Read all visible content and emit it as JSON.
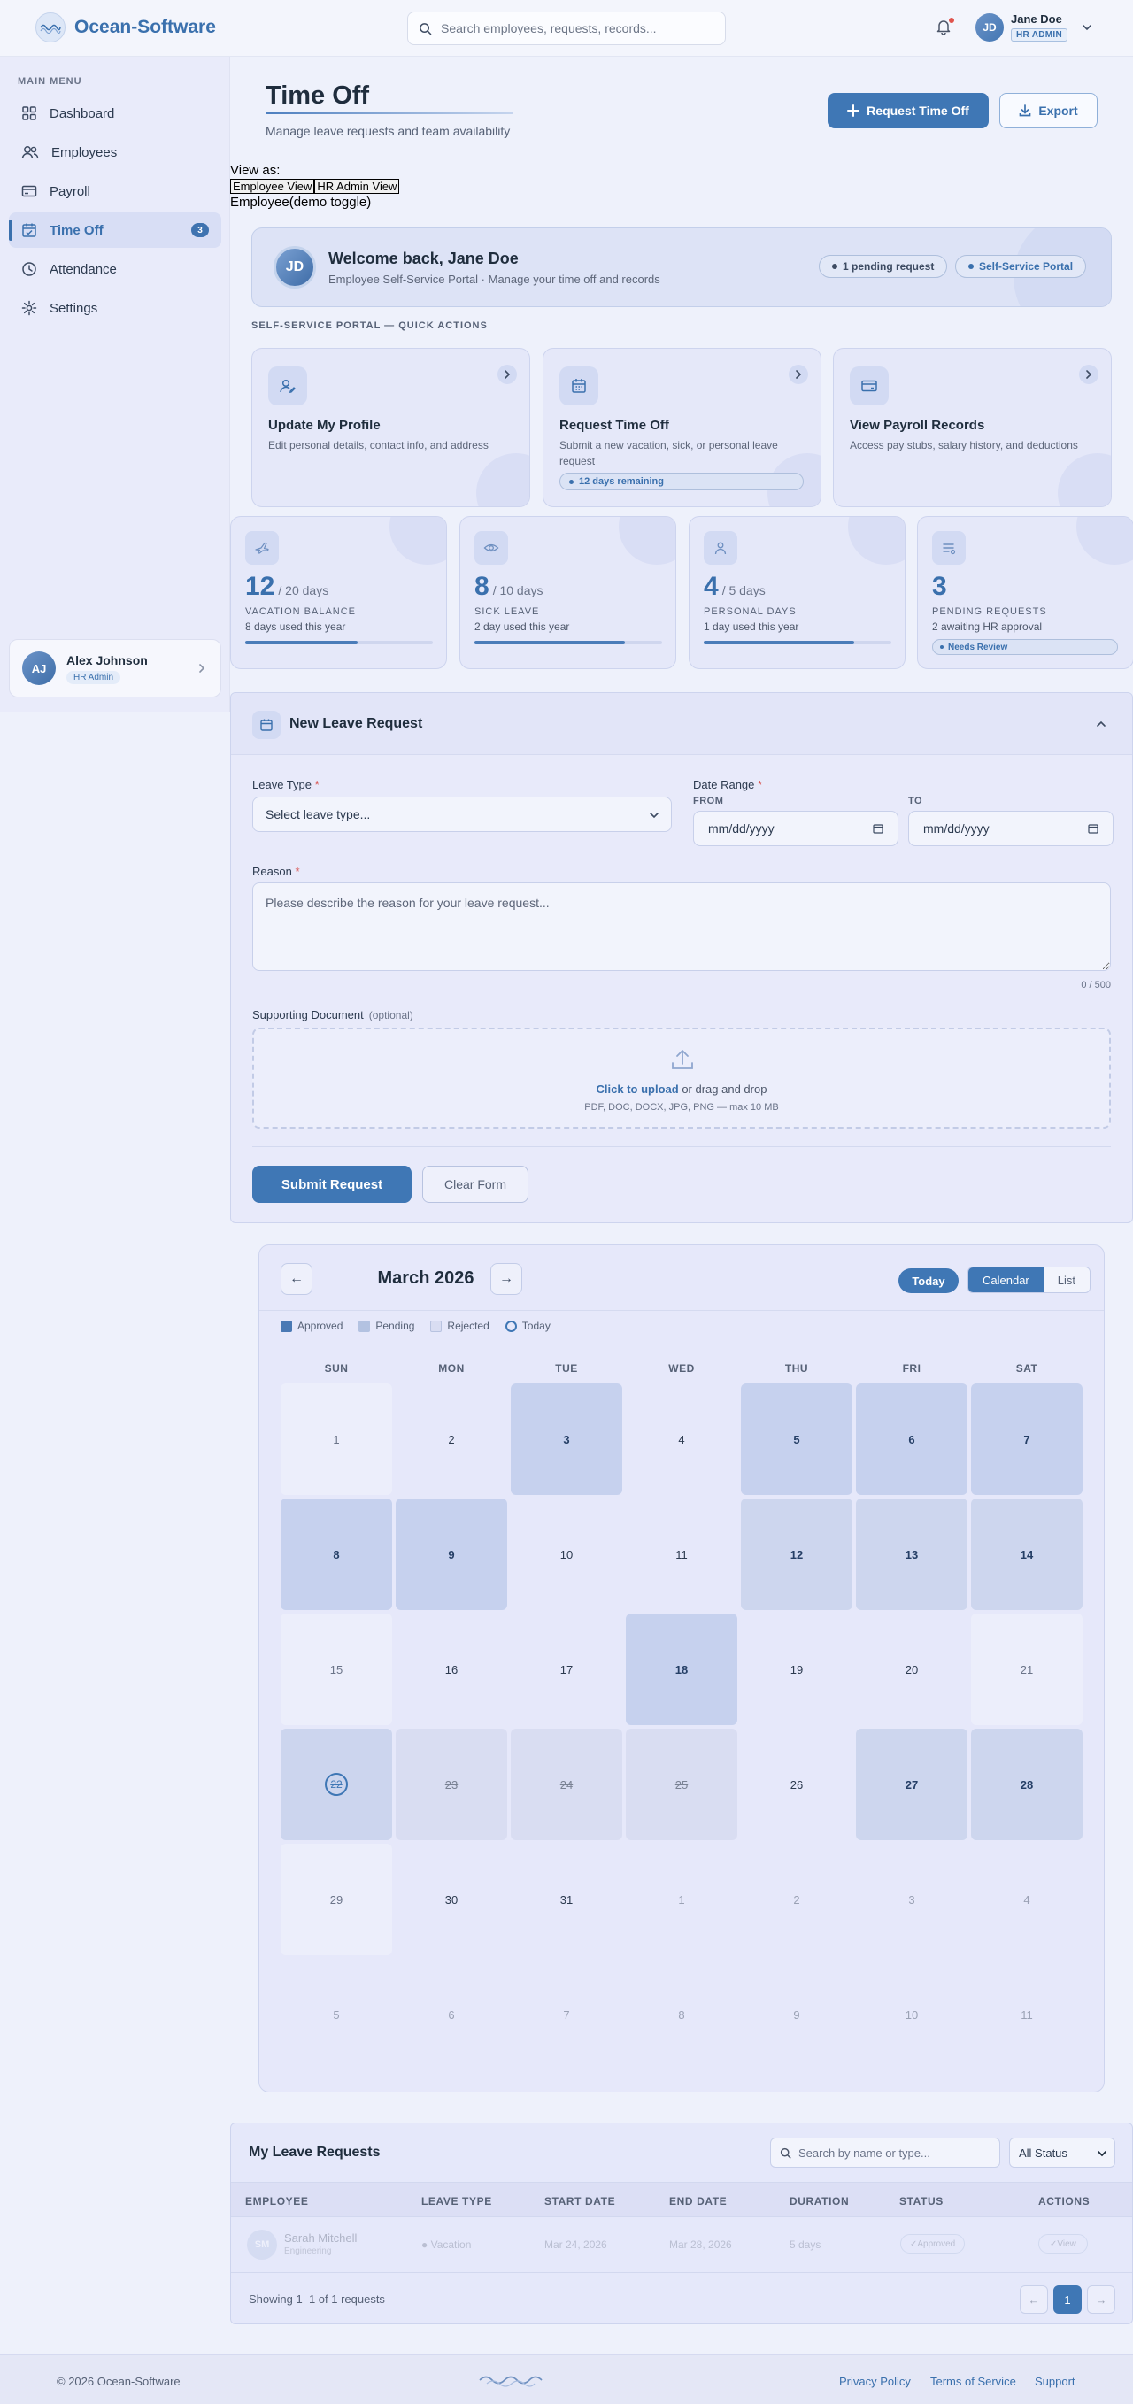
{
  "app": {
    "name": "Ocean-Software",
    "search_placeholder": "Search employees, requests, records..."
  },
  "header_user": {
    "initials": "JD",
    "name": "Jane Doe",
    "role": "HR ADMIN",
    "has_notification": true
  },
  "sidebar": {
    "section_title": "MAIN MENU",
    "items": [
      {
        "label": "Dashboard",
        "icon": "grid-icon"
      },
      {
        "label": "Employees",
        "icon": "users-icon"
      },
      {
        "label": "Payroll",
        "icon": "credit-card-icon"
      },
      {
        "label": "Time Off",
        "icon": "calendar-check-icon",
        "active": true,
        "count": "3"
      },
      {
        "label": "Attendance",
        "icon": "clock-icon"
      },
      {
        "label": "Settings",
        "icon": "gear-icon"
      }
    ],
    "profile": {
      "initials": "AJ",
      "name": "Alex Johnson",
      "role": "HR Admin"
    }
  },
  "page": {
    "title": "Time Off",
    "subtitle": "Manage leave requests and team availability",
    "primary_button": "Request Time Off",
    "export_button": "Export"
  },
  "view_as": {
    "label": "View as:",
    "employee_button": "Employee View",
    "admin_button": "HR Admin View",
    "current": "Employee(demo toggle)"
  },
  "welcome": {
    "initials": "JD",
    "title": "Welcome back, Jane Doe",
    "subtitle": "Employee Self-Service Portal · Manage your time off and records",
    "pill_pending": "1 pending request",
    "pill_portal": "Self-Service Portal"
  },
  "quick_actions": {
    "label": "SELF-SERVICE PORTAL — QUICK ACTIONS",
    "cards": [
      {
        "title": "Update My Profile",
        "desc": "Edit personal details, contact info, and address",
        "icon": "user-edit-icon"
      },
      {
        "title": "Request Time Off",
        "desc": "Submit a new vacation, sick, or personal leave request",
        "tag": "12 days remaining",
        "icon": "calendar-icon"
      },
      {
        "title": "View Payroll Records",
        "desc": "Access pay stubs, salary history, and deductions",
        "icon": "credit-card-icon"
      }
    ]
  },
  "stats": [
    {
      "value": "12",
      "total": "/ 20 days",
      "label": "VACATION BALANCE",
      "sub": "8 days used this year",
      "progress": 0.6,
      "icon": "plane-icon"
    },
    {
      "value": "8",
      "total": "/ 10 days",
      "label": "SICK LEAVE",
      "sub": "2 day used this year",
      "progress": 0.8,
      "icon": "eye-icon"
    },
    {
      "value": "4",
      "total": "/ 5 days",
      "label": "PERSONAL DAYS",
      "sub": "1 day used this year",
      "progress": 0.8,
      "icon": "person-icon"
    },
    {
      "value": "3",
      "total": "",
      "label": "PENDING REQUESTS",
      "sub": "2 awaiting HR approval",
      "tag": "Needs Review",
      "icon": "list-icon"
    }
  ],
  "leave_form": {
    "title": "New Leave Request",
    "leave_type_label": "Leave Type",
    "leave_type_value": "Select leave type...",
    "date_range_label": "Date Range",
    "from_label": "FROM",
    "to_label": "TO",
    "date_placeholder": "mm/dd/yyyy",
    "reason_label": "Reason",
    "reason_placeholder": "Please describe the reason for your leave request...",
    "char_count": "0 / 500",
    "doc_label": "Supporting Document",
    "doc_optional": "(optional)",
    "upload_link": "Click to upload",
    "upload_text": " or drag and drop",
    "upload_hint": "PDF, DOC, DOCX, JPG, PNG — max 10 MB",
    "submit": "Submit Request",
    "clear": "Clear Form",
    "required_mark": "*"
  },
  "calendar": {
    "month": "March 2026",
    "prev": "←",
    "next": "→",
    "today_button": "Today",
    "view_calendar": "Calendar",
    "view_list": "List",
    "legend": [
      "Approved",
      "Pending",
      "Rejected",
      "Today"
    ],
    "weekdays": [
      "SUN",
      "MON",
      "TUE",
      "WED",
      "THU",
      "FRI",
      "SAT"
    ],
    "weeks": [
      [
        {
          "d": "1",
          "s": "weekend"
        },
        {
          "d": "2",
          "s": ""
        },
        {
          "d": "3",
          "s": "approved"
        },
        {
          "d": "4",
          "s": ""
        },
        {
          "d": "5",
          "s": "approved"
        },
        {
          "d": "6",
          "s": "approved"
        },
        {
          "d": "7",
          "s": "approved"
        }
      ],
      [
        {
          "d": "8",
          "s": "approved"
        },
        {
          "d": "9",
          "s": "approved"
        },
        {
          "d": "10",
          "s": ""
        },
        {
          "d": "11",
          "s": ""
        },
        {
          "d": "12",
          "s": "pending"
        },
        {
          "d": "13",
          "s": "pending"
        },
        {
          "d": "14",
          "s": "pending"
        }
      ],
      [
        {
          "d": "15",
          "s": "weekend"
        },
        {
          "d": "16",
          "s": ""
        },
        {
          "d": "17",
          "s": ""
        },
        {
          "d": "18",
          "s": "approved"
        },
        {
          "d": "19",
          "s": ""
        },
        {
          "d": "20",
          "s": ""
        },
        {
          "d": "21",
          "s": "weekend"
        }
      ],
      [
        {
          "d": "22",
          "s": "today"
        },
        {
          "d": "23",
          "s": "rejected"
        },
        {
          "d": "24",
          "s": "rejected"
        },
        {
          "d": "25",
          "s": "rejected"
        },
        {
          "d": "26",
          "s": ""
        },
        {
          "d": "27",
          "s": "pending"
        },
        {
          "d": "28",
          "s": "pending"
        }
      ],
      [
        {
          "d": "29",
          "s": "weekend"
        },
        {
          "d": "30",
          "s": ""
        },
        {
          "d": "31",
          "s": ""
        },
        {
          "d": "1",
          "s": "muted"
        },
        {
          "d": "2",
          "s": "muted"
        },
        {
          "d": "3",
          "s": "muted"
        },
        {
          "d": "4",
          "s": "muted"
        }
      ],
      [
        {
          "d": "5",
          "s": "muted"
        },
        {
          "d": "6",
          "s": "muted"
        },
        {
          "d": "7",
          "s": "muted"
        },
        {
          "d": "8",
          "s": "muted"
        },
        {
          "d": "9",
          "s": "muted"
        },
        {
          "d": "10",
          "s": "muted"
        },
        {
          "d": "11",
          "s": "muted"
        }
      ]
    ]
  },
  "requests": {
    "title": "My Leave Requests",
    "search_placeholder": "Search by name or type...",
    "filter_value": "All Status",
    "columns": [
      "EMPLOYEE",
      "LEAVE TYPE",
      "START DATE",
      "END DATE",
      "DURATION",
      "STATUS",
      "ACTIONS"
    ],
    "rows": [
      {
        "initials": "SM",
        "name": "Sarah Mitchell",
        "dept": "Engineering",
        "type": "Vacation",
        "start": "Mar 24, 2026",
        "end": "Mar 28, 2026",
        "duration": "5 days",
        "status": "Approved",
        "action": "View"
      }
    ],
    "showing": "Showing 1–1 of 1 requests",
    "page_prev": "←",
    "page_current": "1",
    "page_next": "→"
  },
  "footer": {
    "copyright": "© 2026 Ocean-Software",
    "links": [
      "Privacy Policy",
      "Terms of Service",
      "Support"
    ]
  },
  "colors": {
    "accent": "#3f77b5",
    "approved": "#4a79b4",
    "pending": "#b3c2e1",
    "rejected": "#d9ddf2"
  }
}
